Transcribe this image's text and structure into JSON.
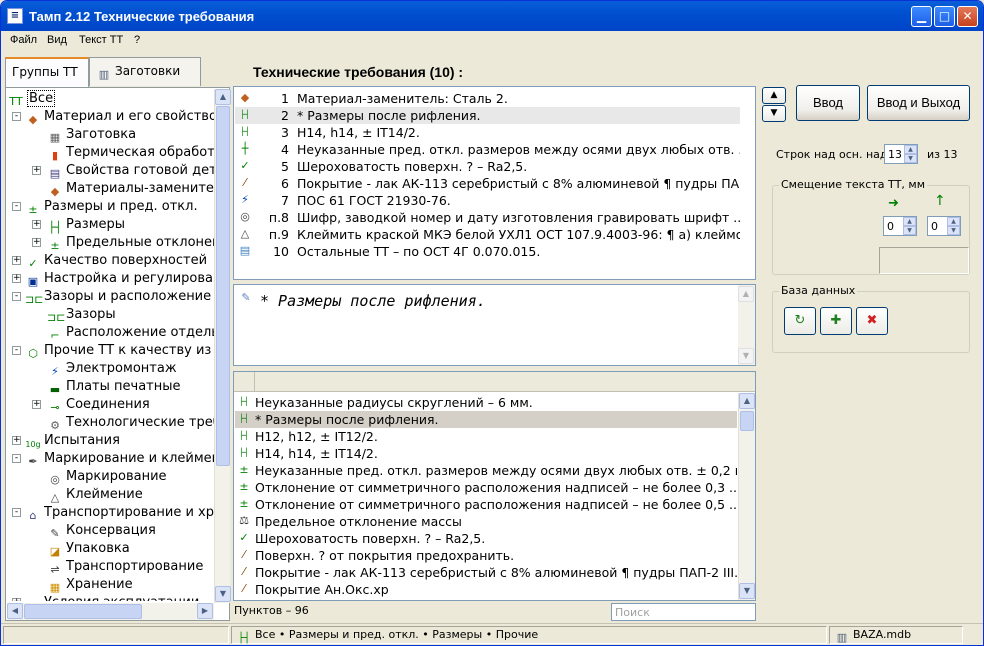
{
  "window": {
    "title": "Тамп 2.12 Технические требования"
  },
  "menu": [
    "Файл",
    "Вид",
    "Текст ТТ",
    "?"
  ],
  "tabs": [
    "Группы ТТ",
    "Заготовки"
  ],
  "tree": [
    {
      "label": "Все",
      "indent": 0,
      "toggle": "",
      "icon": "ТТ",
      "icon_name": "tt-root-icon",
      "color": "#008000"
    },
    {
      "label": "Материал и его свойство",
      "indent": 0,
      "toggle": "-",
      "icon": "◆",
      "icon_name": "material-icon",
      "color": "#c06020"
    },
    {
      "label": "Заготовка",
      "indent": 2,
      "toggle": "",
      "icon": "▦",
      "icon_name": "blank-icon",
      "color": "#606060"
    },
    {
      "label": "Термическая обработ",
      "indent": 2,
      "toggle": "",
      "icon": "▮",
      "icon_name": "heat-treatment-icon",
      "color": "#e04010"
    },
    {
      "label": "Свойства готовой дет",
      "indent": 1,
      "toggle": "+",
      "icon": "▤",
      "icon_name": "properties-icon",
      "color": "#404080"
    },
    {
      "label": "Материалы-заменител",
      "indent": 2,
      "toggle": "",
      "icon": "◆",
      "icon_name": "substitute-icon",
      "color": "#c06020"
    },
    {
      "label": "Размеры и пред. откл.",
      "indent": 0,
      "toggle": "-",
      "icon": "±",
      "icon_name": "dimensions-icon",
      "color": "#008000"
    },
    {
      "label": "Размеры",
      "indent": 1,
      "toggle": "+",
      "icon": "├┤",
      "icon_name": "sizes-icon",
      "color": "#008000"
    },
    {
      "label": "Предельные отклонен",
      "indent": 1,
      "toggle": "+",
      "icon": "±",
      "icon_name": "tolerance-icon",
      "color": "#008000"
    },
    {
      "label": "Качество поверхностей",
      "indent": 0,
      "toggle": "+",
      "icon": "✓",
      "icon_name": "surface-quality-icon",
      "color": "#008000"
    },
    {
      "label": "Настройка и регулирова",
      "indent": 0,
      "toggle": "+",
      "icon": "▣",
      "icon_name": "adjustment-icon",
      "color": "#003090"
    },
    {
      "label": "Зазоры и расположение",
      "indent": 0,
      "toggle": "-",
      "icon": "⊐⊏",
      "icon_name": "gaps-icon",
      "color": "#008000"
    },
    {
      "label": "Зазоры",
      "indent": 2,
      "toggle": "",
      "icon": "⊐⊏",
      "icon_name": "gap-icon",
      "color": "#008000"
    },
    {
      "label": "Расположение отдель",
      "indent": 2,
      "toggle": "",
      "icon": "⌐",
      "icon_name": "location-icon",
      "color": "#008000"
    },
    {
      "label": "Прочие ТТ к качеству из",
      "indent": 0,
      "toggle": "-",
      "icon": "⬡",
      "icon_name": "other-requirements-icon",
      "color": "#008000"
    },
    {
      "label": "Электромонтаж",
      "indent": 2,
      "toggle": "",
      "icon": "⚡",
      "icon_name": "wiring-icon",
      "color": "#0040c0"
    },
    {
      "label": "Платы печатные",
      "indent": 2,
      "toggle": "",
      "icon": "▬",
      "icon_name": "pcb-icon",
      "color": "#006000"
    },
    {
      "label": "Соединения",
      "indent": 1,
      "toggle": "+",
      "icon": "⊸",
      "icon_name": "joints-icon",
      "color": "#008000"
    },
    {
      "label": "Технологические треб",
      "indent": 2,
      "toggle": "",
      "icon": "⚙",
      "icon_name": "technology-icon",
      "color": "#606060"
    },
    {
      "label": "Испытания",
      "indent": 0,
      "toggle": "+",
      "icon": "10g",
      "icon_name": "tests-icon",
      "color": "#008000"
    },
    {
      "label": "Маркирование и клеймен",
      "indent": 0,
      "toggle": "-",
      "icon": "✒",
      "icon_name": "marking-icon",
      "color": "#404040"
    },
    {
      "label": "Маркирование",
      "indent": 2,
      "toggle": "",
      "icon": "◎",
      "icon_name": "marking-sub-icon",
      "color": "#404040"
    },
    {
      "label": "Клеймение",
      "indent": 2,
      "toggle": "",
      "icon": "△",
      "icon_name": "stamping-icon",
      "color": "#404040"
    },
    {
      "label": "Транспортирование и хр",
      "indent": 0,
      "toggle": "-",
      "icon": "⌂",
      "icon_name": "transport-icon",
      "color": "#404080"
    },
    {
      "label": "Консервация",
      "indent": 2,
      "toggle": "",
      "icon": "✎",
      "icon_name": "conservation-icon",
      "color": "#404040"
    },
    {
      "label": "Упаковка",
      "indent": 2,
      "toggle": "",
      "icon": "◪",
      "icon_name": "package-icon",
      "color": "#c08000"
    },
    {
      "label": "Транспортирование",
      "indent": 2,
      "toggle": "",
      "icon": "⇌",
      "icon_name": "transportation-icon",
      "color": "#404040"
    },
    {
      "label": "Хранение",
      "indent": 2,
      "toggle": "",
      "icon": "▦",
      "icon_name": "storage-icon",
      "color": "#d09000"
    },
    {
      "label": "Условия эксплуатации",
      "indent": 0,
      "toggle": "+",
      "icon": "☀",
      "icon_name": "operation-icon",
      "color": "#e0a000"
    }
  ],
  "main": {
    "heading": "Технические требования (10) :",
    "requirements": [
      {
        "num": "1",
        "text": "Материал-заменитель: Сталь 2.",
        "icon": "◆",
        "icon_name": "material-icon",
        "color": "#c06020"
      },
      {
        "num": "2",
        "text": "* Размеры после рифления.",
        "icon": "├┤",
        "icon_name": "sizes-icon",
        "color": "#008000"
      },
      {
        "num": "3",
        "text": "H14, h14, ± IT14/2.",
        "icon": "├┤",
        "icon_name": "sizes-icon",
        "color": "#008000"
      },
      {
        "num": "4",
        "text": "Неуказанные пред. откл. размеров между осями двух любых отв. ...",
        "icon": "┼",
        "icon_name": "tolerance-icon",
        "color": "#008000"
      },
      {
        "num": "5",
        "text": "Шероховатость поверхн. ? – Ra2,5.",
        "icon": "✓",
        "icon_name": "roughness-icon",
        "color": "#008000"
      },
      {
        "num": "6",
        "text": "Покрытие - лак АК-113 серебристый с 8% алюминевой ¶ пудры ПА...",
        "icon": "⁄",
        "icon_name": "coating-icon",
        "color": "#804000"
      },
      {
        "num": "7",
        "text": "ПОС 61 ГОСТ 21930-76.",
        "icon": "⚡",
        "icon_name": "solder-icon",
        "color": "#0040c0"
      },
      {
        "num": "п.8",
        "text": "Шифр, заводкой номер и дату изготовления гравировать шрифт ...",
        "icon": "◎",
        "icon_name": "engraving-icon",
        "color": "#404040"
      },
      {
        "num": "п.9",
        "text": "Клеймить краской МКЭ белой УХЛ1 ОСТ 107.9.4003-96: ¶ а) клеймо ...",
        "icon": "△",
        "icon_name": "stamp-icon",
        "color": "#404040"
      },
      {
        "num": "10",
        "text": "Остальные ТТ – по ОСТ 4Г 0.070.015.",
        "icon": "▤",
        "icon_name": "other-icon",
        "color": "#4080c0"
      }
    ],
    "selected_index": 1,
    "preview_text": "* Размеры после рифления.",
    "templates": [
      {
        "text": "Неуказанные радиусы скруглений – 6 мм.",
        "icon": "├┤",
        "icon_name": "sizes-icon",
        "color": "#008000"
      },
      {
        "text": "* Размеры после рифления.",
        "icon": "├┤",
        "icon_name": "sizes-icon",
        "color": "#008000"
      },
      {
        "text": "H12, h12, ± IT12/2.",
        "icon": "├┤",
        "icon_name": "sizes-icon",
        "color": "#008000"
      },
      {
        "text": "H14, h14, ± IT14/2.",
        "icon": "├┤",
        "icon_name": "sizes-icon",
        "color": "#008000"
      },
      {
        "text": "Неуказанные пред. откл. размеров между осями двух любых отв. ± 0,2 мм.",
        "icon": "±",
        "icon_name": "tolerance-icon",
        "color": "#008000"
      },
      {
        "text": "Отклонение от симметричного расположения надписей – не более 0,3 ...",
        "icon": "±",
        "icon_name": "tolerance-icon",
        "color": "#008000"
      },
      {
        "text": "Отклонение от симметричного расположения надписей – не более 0,5 ...",
        "icon": "±",
        "icon_name": "tolerance-icon",
        "color": "#008000"
      },
      {
        "text": "Предельное отклонение массы",
        "icon": "⚖",
        "icon_name": "mass-icon",
        "color": "#303030"
      },
      {
        "text": "Шероховатость поверхн. ? – Ra2,5.",
        "icon": "✓",
        "icon_name": "roughness-icon",
        "color": "#008000"
      },
      {
        "text": "Поверхн. ? от покрытия предохранить.",
        "icon": "⁄",
        "icon_name": "coating-icon",
        "color": "#804000"
      },
      {
        "text": "Покрытие - лак АК-113 серебристый с 8% алюминевой ¶ пудры ПАП-2 III.У...",
        "icon": "⁄",
        "icon_name": "coating-icon",
        "color": "#804000"
      },
      {
        "text": "Покрытие Ан.Окс.хр",
        "icon": "⁄",
        "icon_name": "coating-icon",
        "color": "#804000"
      }
    ],
    "templates_selected_index": 1,
    "items_count": "Пунктов – 96",
    "search_placeholder": "Поиск"
  },
  "right": {
    "enter_label": "Ввод",
    "enter_exit_label": "Ввод и Выход",
    "rows_label": "Строк над осн. надп.",
    "rows_value": "13",
    "rows_of": "из 13",
    "offset_group": "Смещение текста ТТ, мм",
    "offset_x": "0",
    "offset_y": "0",
    "db_group": "База данных"
  },
  "status": {
    "path": "Все • Размеры и пред. откл. • Размеры • Прочие",
    "db_file": "BAZA.mdb"
  }
}
